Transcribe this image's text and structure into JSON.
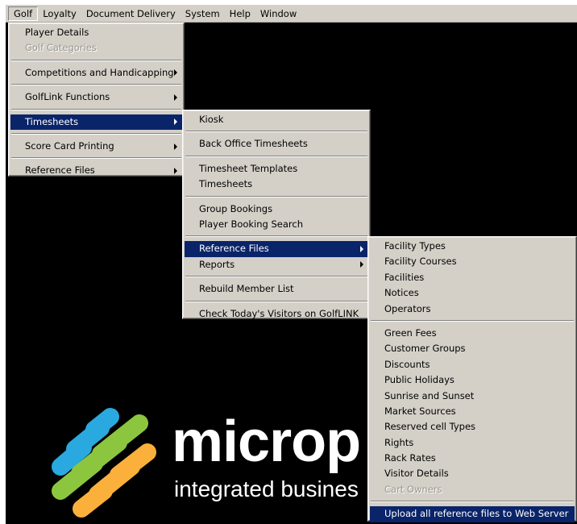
{
  "menubar": {
    "items": [
      "Golf",
      "Loyalty",
      "Document Delivery",
      "System",
      "Help",
      "Window"
    ],
    "active": "Golf"
  },
  "golf_menu": {
    "player_details": "Player Details",
    "golf_categories": "Golf Categories",
    "competitions": "Competitions and Handicapping",
    "golflink_functions": "GolfLink Functions",
    "timesheets": "Timesheets",
    "score_card_printing": "Score Card Printing",
    "reference_files": "Reference Files"
  },
  "timesheets_menu": {
    "kiosk": "Kiosk",
    "back_office": "Back Office Timesheets",
    "templates": "Timesheet Templates",
    "timesheets": "Timesheets",
    "group_bookings": "Group Bookings",
    "player_booking_search": "Player Booking Search",
    "reference_files": "Reference Files",
    "reports": "Reports",
    "rebuild_member_list": "Rebuild Member List",
    "check_visitors": "Check Today's Visitors on GolfLINK"
  },
  "reference_files_menu": {
    "facility_types": "Facility Types",
    "facility_courses": "Facility Courses",
    "facilities": "Facilities",
    "notices": "Notices",
    "operators": "Operators",
    "green_fees": "Green Fees",
    "customer_groups": "Customer Groups",
    "discounts": "Discounts",
    "public_holidays": "Public Holidays",
    "sunrise_sunset": "Sunrise and Sunset",
    "market_sources": "Market Sources",
    "reserved_cell_types": "Reserved cell Types",
    "rights": "Rights",
    "rack_rates": "Rack Rates",
    "visitor_details": "Visitor Details",
    "cart_owners": "Cart Owners",
    "upload_all": "Upload all reference files to Web Server"
  },
  "brand": {
    "name": "microp",
    "tagline": "integrated busines",
    "colors": [
      "#29a9e0",
      "#8cc63f",
      "#fbb03b"
    ]
  }
}
